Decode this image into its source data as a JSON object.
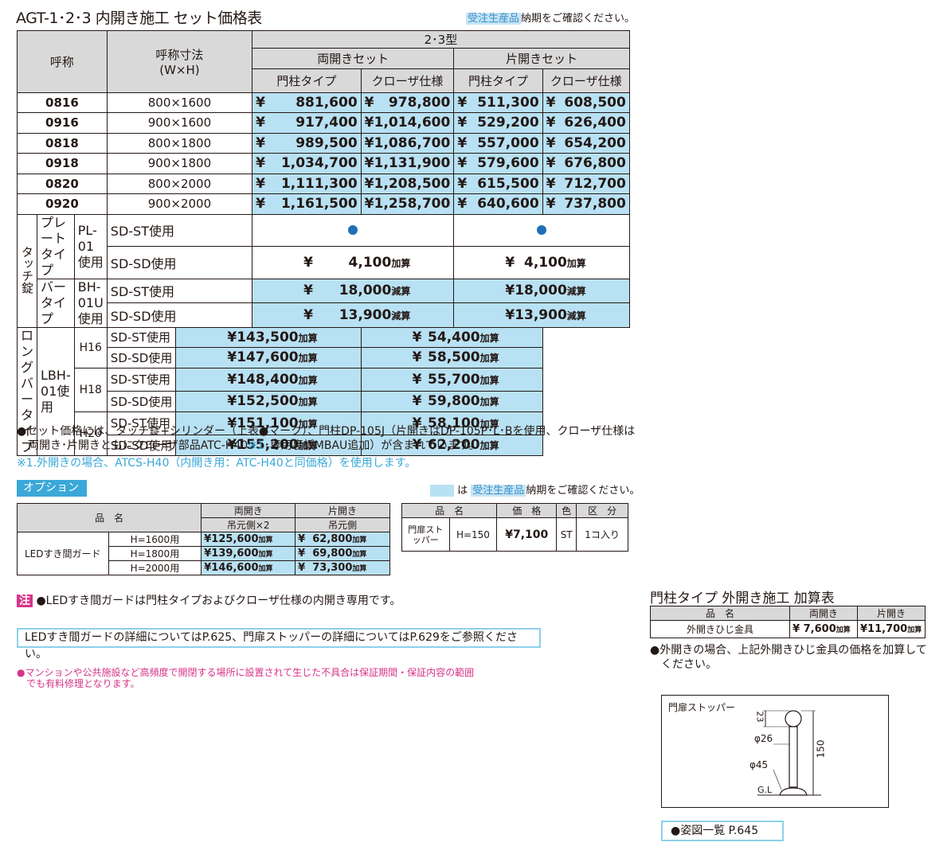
{
  "title": "AGT-1･2･3 内開き施工 セット価格表",
  "top_badge": "受注生産品",
  "top_note": "納期をご確認ください。",
  "header": {
    "name": "呼称",
    "size": "呼称寸法",
    "size_sub": "(W×H)",
    "type": "2･3型",
    "double": "両開きセット",
    "single": "片開きセット",
    "post": "門柱タイプ",
    "closer": "クローザ仕様"
  },
  "rows": [
    {
      "code": "0816",
      "size": "800×1600",
      "d_post": "881,600",
      "d_closer": "978,800",
      "s_post": "511,300",
      "s_closer": "608,500"
    },
    {
      "code": "0916",
      "size": "900×1600",
      "d_post": "917,400",
      "d_closer": "1,014,600",
      "s_post": "529,200",
      "s_closer": "626,400"
    },
    {
      "code": "0818",
      "size": "800×1800",
      "d_post": "989,500",
      "d_closer": "1,086,700",
      "s_post": "557,000",
      "s_closer": "654,200"
    },
    {
      "code": "0918",
      "size": "900×1800",
      "d_post": "1,034,700",
      "d_closer": "1,131,900",
      "s_post": "579,600",
      "s_closer": "676,800"
    },
    {
      "code": "0820",
      "size": "800×2000",
      "d_post": "1,111,300",
      "d_closer": "1,208,500",
      "s_post": "615,500",
      "s_closer": "712,700"
    },
    {
      "code": "0920",
      "size": "900×2000",
      "d_post": "1,161,500",
      "d_closer": "1,258,700",
      "s_post": "640,600",
      "s_closer": "737,800"
    }
  ],
  "yen": "¥",
  "lock": {
    "label": "タッチ錠",
    "plate": {
      "name": "プレートタイプ",
      "model": "PL-01使用",
      "st": "SD-ST使用",
      "sd": "SD-SD使用",
      "sd_d": "4,100",
      "sd_s": "4,100",
      "suffix": "加算"
    },
    "bar": {
      "name": "バータイプ",
      "model": "BH-01U使用",
      "st": "SD-ST使用",
      "sd": "SD-SD使用",
      "st_d": "18,000",
      "st_s": "18,000",
      "sd_d": "13,900",
      "sd_s": "13,900",
      "suffix": "減算"
    },
    "long": {
      "name": "ロングバータイプ",
      "model": "LBH-01使用",
      "rows": [
        {
          "h": "H16",
          "st": "SD-ST使用",
          "sd": "SD-SD使用",
          "st_d": "143,500",
          "st_s": "54,400",
          "sd_d": "147,600",
          "sd_s": "58,500"
        },
        {
          "h": "H18",
          "st": "SD-ST使用",
          "sd": "SD-SD使用",
          "st_d": "148,400",
          "st_s": "55,700",
          "sd_d": "152,500",
          "sd_s": "59,800"
        },
        {
          "h": "H20",
          "st": "SD-ST使用",
          "sd": "SD-SD使用",
          "st_d": "151,100",
          "st_s": "58,100",
          "sd_d": "155,200",
          "sd_s": "62,200"
        }
      ],
      "suffix": "加算"
    }
  },
  "notes": {
    "n1": "●セット価格には、タッチ錠+シリンダー（上表●マーク）、門柱DP-105J（片開きはDP-105P･L･Bを使用、クローザ仕様は",
    "n2a": "両開き･片開きともにクローザ部品ATC-H40",
    "n2b": "※1",
    "n2c": "･専用裏板MBAU追加）が含まれています。",
    "n3": "※1.外開きの場合、ATCS-H40（内開き用：ATC-H40と同価格）を使用します。"
  },
  "option": {
    "label": "オプション",
    "legend_ha": "は",
    "badge": "受注生産品",
    "legend_note": "納期をご確認ください。",
    "h_name": "品　名",
    "h_double": "両開き",
    "h_double_sub": "吊元側×2",
    "h_single": "片開き",
    "h_single_sub": "吊元側",
    "item": "LEDすき間ガード",
    "rows": [
      {
        "h": "H=1600用",
        "d": "125,600",
        "s": "62,800"
      },
      {
        "h": "H=1800用",
        "d": "139,600",
        "s": "69,800"
      },
      {
        "h": "H=2000用",
        "d": "146,600",
        "s": "73,300"
      }
    ],
    "suffix": "加算",
    "s_name": "品　名",
    "s_price": "価　格",
    "s_color": "色",
    "s_unit": "区　分",
    "s_item": "門扉ストッパー",
    "s_h": "H=150",
    "s_val": "¥7,100",
    "s_col": "ST",
    "s_qty": "1コ入り"
  },
  "chu": "注",
  "chu_text": "●LEDすき間ガードは門柱タイプおよびクローザ仕様の内開き専用です。",
  "ref": "LEDすき間ガードの詳細についてはP.625、門扉ストッパーの詳細についてはP.629をご参照ください。",
  "pink1": "●マンションや公共施設など高頻度で開閉する場所に設置されて生じた不具合は保証期間・保証内容の範囲",
  "pink2": "でも有料修理となります。",
  "outer": {
    "title": "門柱タイプ 外開き施工 加算表",
    "h_name": "品　名",
    "h_double": "両開き",
    "h_single": "片開き",
    "item": "外開きひじ金具",
    "d": "¥ 7,600",
    "s": "¥11,700",
    "suffix": "加算",
    "note1": "●外開きの場合、上記外開きひじ金具の価格を加算して",
    "note2": "ください。"
  },
  "diagram": {
    "title": "門扉ストッパー",
    "d23": "23",
    "d26": "φ26",
    "d45": "φ45",
    "d150": "150",
    "gl": "G.L"
  },
  "figlist": "●姿図一覧 P.645"
}
